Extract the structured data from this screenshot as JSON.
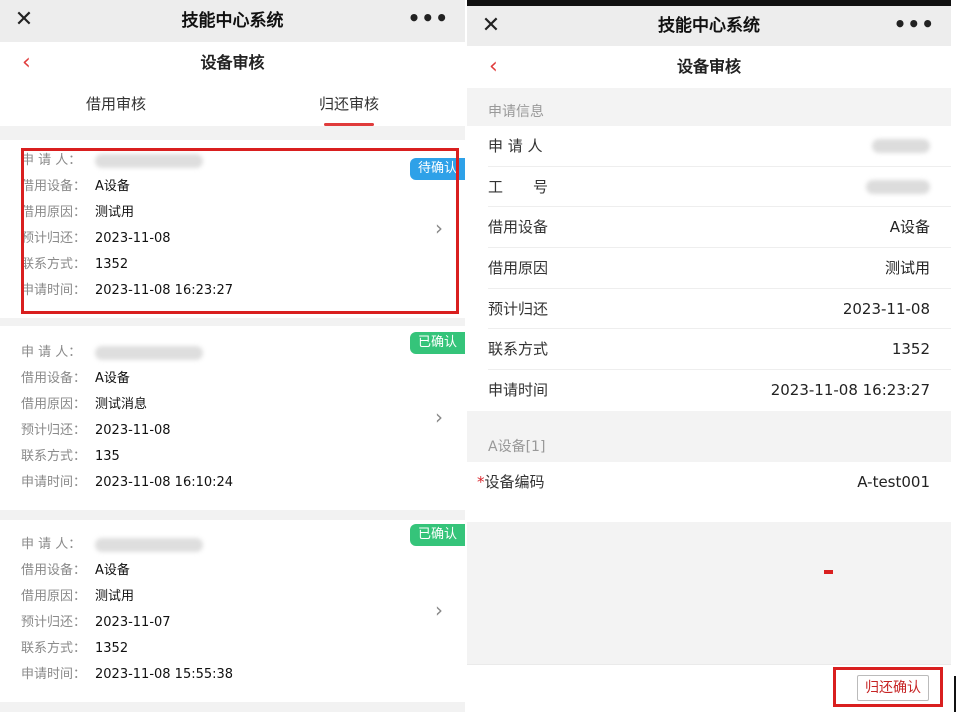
{
  "app": {
    "title": "技能中心系统",
    "more": "•••",
    "close": "✕"
  },
  "left": {
    "page_title": "设备审核",
    "back": "‹",
    "tabs": [
      "借用审核",
      "归还审核"
    ],
    "active_tab": 1,
    "cards": [
      {
        "status": "待确认",
        "status_color": "#2ea1e8",
        "labels": [
          "申 请 人：",
          "借用设备：",
          "借用原因：",
          "预计归还：",
          "联系方式：",
          "申请时间："
        ],
        "device": "A设备",
        "reason": "测试用",
        "return_date": "2023-11-08",
        "contact": "1352",
        "apply_time": "2023-11-08 16:23:27"
      },
      {
        "status": "已确认",
        "status_color": "#35c47a",
        "labels": [
          "申 请 人：",
          "借用设备：",
          "借用原因：",
          "预计归还：",
          "联系方式：",
          "申请时间："
        ],
        "device": "A设备",
        "reason": "测试消息",
        "return_date": "2023-11-08",
        "contact": "135",
        "apply_time": "2023-11-08 16:10:24"
      },
      {
        "status": "已确认",
        "status_color": "#35c47a",
        "labels": [
          "申 请 人：",
          "借用设备：",
          "借用原因：",
          "预计归还：",
          "联系方式：",
          "申请时间："
        ],
        "device": "A设备",
        "reason": "测试用",
        "return_date": "2023-11-07",
        "contact": "1352",
        "apply_time": "2023-11-08 15:55:38"
      }
    ]
  },
  "right": {
    "page_title": "设备审核",
    "back": "‹",
    "section_apply": "申请信息",
    "fields": [
      {
        "key": "申 请 人",
        "value": ""
      },
      {
        "key": "工　　号",
        "value": ""
      },
      {
        "key": "借用设备",
        "value": "A设备"
      },
      {
        "key": "借用原因",
        "value": "测试用"
      },
      {
        "key": "预计归还",
        "value": "2023-11-08"
      },
      {
        "key": "联系方式",
        "value": "1352"
      },
      {
        "key": "申请时间",
        "value": "2023-11-08 16:23:27"
      }
    ],
    "section_device": "A设备[1]",
    "device_code_label": "设备编码",
    "device_code_required": "*",
    "device_code_value": "A-test001",
    "confirm_button": "归还确认"
  },
  "colors": {
    "accent": "#e03b3b",
    "pending": "#2ea1e8",
    "confirmed": "#35c47a",
    "highlight": "#d91f1f"
  }
}
